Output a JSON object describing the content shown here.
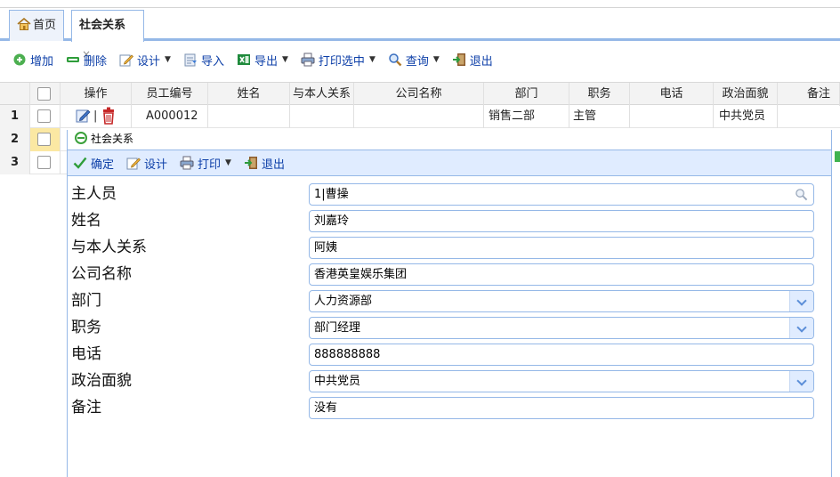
{
  "tabs": [
    {
      "label": "首页",
      "icon": "home-icon"
    },
    {
      "label": "社会关系",
      "close": "×"
    }
  ],
  "toolbar": {
    "add": "增加",
    "delete": "删除",
    "design": "设计",
    "import": "导入",
    "export": "导出",
    "print_selected": "打印选中",
    "query": "查询",
    "exit": "退出"
  },
  "grid": {
    "columns": [
      "操作",
      "员工编号",
      "姓名",
      "与本人关系",
      "公司名称",
      "部门",
      "职务",
      "电话",
      "政治面貌",
      "备注"
    ],
    "rows": [
      {
        "no": "1",
        "emp_id": "A000012",
        "name": "",
        "relation": "",
        "company": "",
        "dept": "销售二部",
        "position": "主管",
        "phone": "",
        "political": "中共党员",
        "remark": ""
      },
      {
        "no": "2"
      },
      {
        "no": "3"
      }
    ]
  },
  "dialog": {
    "title": "社会关系",
    "toolbar": {
      "confirm": "确定",
      "design": "设计",
      "print": "打印",
      "exit": "退出"
    },
    "fields": [
      {
        "label": "主人员",
        "value": "1|曹操",
        "type": "search"
      },
      {
        "label": "姓名",
        "value": "刘嘉玲",
        "type": "text"
      },
      {
        "label": "与本人关系",
        "value": "阿姨",
        "type": "text"
      },
      {
        "label": "公司名称",
        "value": "香港英皇娱乐集团",
        "type": "text"
      },
      {
        "label": "部门",
        "value": "人力资源部",
        "type": "combo"
      },
      {
        "label": "职务",
        "value": "部门经理",
        "type": "combo"
      },
      {
        "label": "电话",
        "value": "888888888",
        "type": "text"
      },
      {
        "label": "政治面貌",
        "value": "中共党员",
        "type": "combo"
      },
      {
        "label": "备注",
        "value": "没有",
        "type": "text"
      }
    ]
  },
  "colors": {
    "accent": "#95b8e7",
    "link": "#0d3fa8",
    "toolbar_bg": "#e0ecff"
  }
}
